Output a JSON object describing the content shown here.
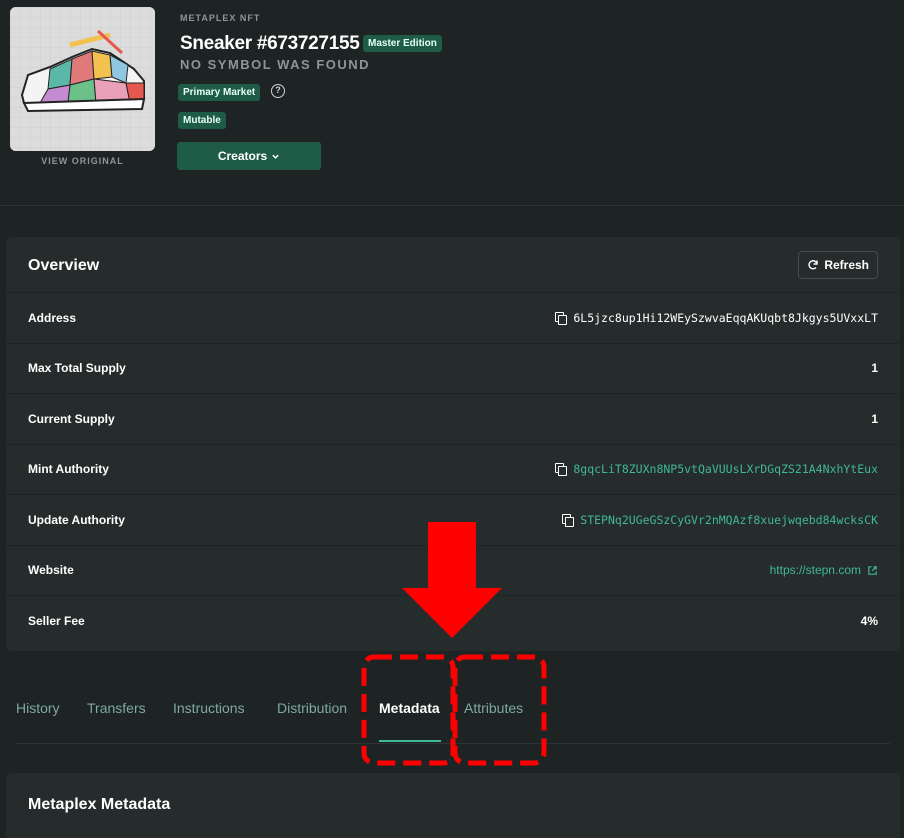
{
  "header": {
    "brand": "METAPLEX NFT",
    "title": "Sneaker #673727155",
    "edition_badge": "Master Edition",
    "symbol": "NO SYMBOL WAS FOUND",
    "primary_market_badge": "Primary Market",
    "help_glyph": "?",
    "mutable_badge": "Mutable",
    "creators_label": "Creators",
    "view_original": "VIEW ORIGINAL"
  },
  "overview": {
    "title": "Overview",
    "refresh_label": "Refresh",
    "rows": [
      {
        "label": "Address",
        "value": "6L5jzc8up1Hi12WEySzwvaEqqAKUqbt8Jkgys5UVxxLT"
      },
      {
        "label": "Max Total Supply",
        "value": "1"
      },
      {
        "label": "Current Supply",
        "value": "1"
      },
      {
        "label": "Mint Authority",
        "value": "8gqcLiT8ZUXn8NP5vtQaVUUsLXrDGqZS21A4NxhYtEux"
      },
      {
        "label": "Update Authority",
        "value": "STEPNq2UGeGSzCyGVr2nMQAzf8xuejwqebd84wcksCK"
      },
      {
        "label": "Website",
        "value": "https://stepn.com"
      },
      {
        "label": "Seller Fee",
        "value": "4%"
      }
    ]
  },
  "tabs": [
    {
      "label": "History"
    },
    {
      "label": "Transfers"
    },
    {
      "label": "Instructions"
    },
    {
      "label": "Distribution"
    },
    {
      "label": "Metadata"
    },
    {
      "label": "Attributes"
    }
  ],
  "metadata_card": {
    "title": "Metaplex Metadata"
  },
  "icons": {
    "copy": "copy-icon",
    "external": "external-link-icon",
    "refresh": "refresh-icon",
    "chevron": "chevron-down-icon"
  },
  "colors": {
    "background": "#1e2424",
    "card": "#262c2c",
    "accent": "#3fb895",
    "badge": "#1f5c48",
    "annotation": "#ff0000"
  }
}
